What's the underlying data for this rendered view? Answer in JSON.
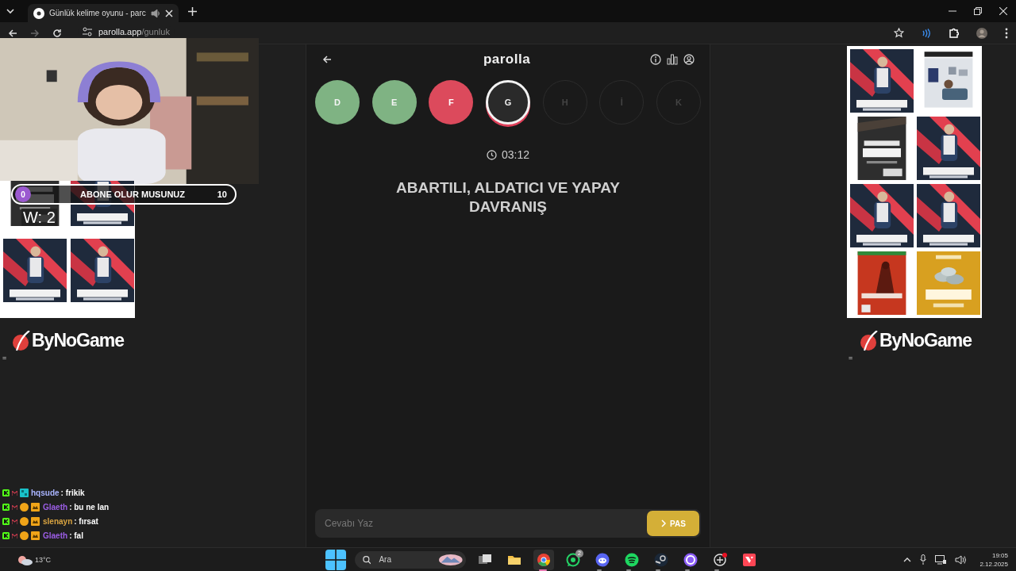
{
  "browser": {
    "tab": {
      "title": "Günlük kelime oyunu - parc"
    },
    "address": {
      "host": "parolla.app",
      "path": "/gunluk"
    }
  },
  "game": {
    "title": "parolla",
    "letters": [
      {
        "letter": "D",
        "correct": true,
        "wrong": false,
        "selected": false
      },
      {
        "letter": "E",
        "correct": true,
        "wrong": false,
        "selected": false
      },
      {
        "letter": "F",
        "correct": false,
        "wrong": true,
        "selected": false
      },
      {
        "letter": "G",
        "correct": false,
        "wrong": false,
        "selected": true
      },
      {
        "letter": "H",
        "correct": false,
        "wrong": false,
        "selected": false
      },
      {
        "letter": "İ",
        "correct": false,
        "wrong": false,
        "selected": false
      },
      {
        "letter": "K",
        "correct": false,
        "wrong": false,
        "selected": false
      }
    ],
    "timer": "03:12",
    "question": "ABARTILI, ALDATICI VE YAPAY DAVRANIŞ",
    "answer": {
      "placeholder": "Cevabı Yaz"
    },
    "pass_button": "PAS"
  },
  "stream_overlay": {
    "subgoal": {
      "current": "0",
      "label": "ABONE OLUR MUSUNUZ",
      "target": "10"
    },
    "record": "W: 2",
    "left_logo": "ByNoGame",
    "left_marker": "=",
    "right_logo": "ByNoGame",
    "right_marker": "=",
    "chat": [
      {
        "user": "hqsude",
        "color": "#a9b4ff",
        "message": ": frikik"
      },
      {
        "user": "Glaeth",
        "color": "#9b5de5",
        "message": ": bu ne lan"
      },
      {
        "user": "slenayn",
        "color": "#d9a441",
        "message": ": fırsat"
      },
      {
        "user": "Glaeth",
        "color": "#9b5de5",
        "message": ": fal"
      }
    ]
  },
  "weather": {
    "temperature": "13°C"
  },
  "taskbar": {
    "search_placeholder": "Ara",
    "apps": [
      {
        "kind": "taskview",
        "selected": false,
        "running": false
      },
      {
        "kind": "folder",
        "selected": false,
        "running": false
      },
      {
        "kind": "chrome",
        "selected": true,
        "running": true
      },
      {
        "kind": "whatsapp",
        "selected": false,
        "running": false,
        "badge": "2"
      },
      {
        "kind": "discord",
        "selected": false,
        "running": true
      },
      {
        "kind": "spotify",
        "selected": false,
        "running": true
      },
      {
        "kind": "steam",
        "selected": false,
        "running": true
      },
      {
        "kind": "ring",
        "selected": false,
        "running": true
      },
      {
        "kind": "dotapp",
        "selected": false,
        "running": true
      },
      {
        "kind": "valorant",
        "selected": false,
        "running": false
      }
    ],
    "time": "19:05",
    "date": "2.12.2025"
  }
}
